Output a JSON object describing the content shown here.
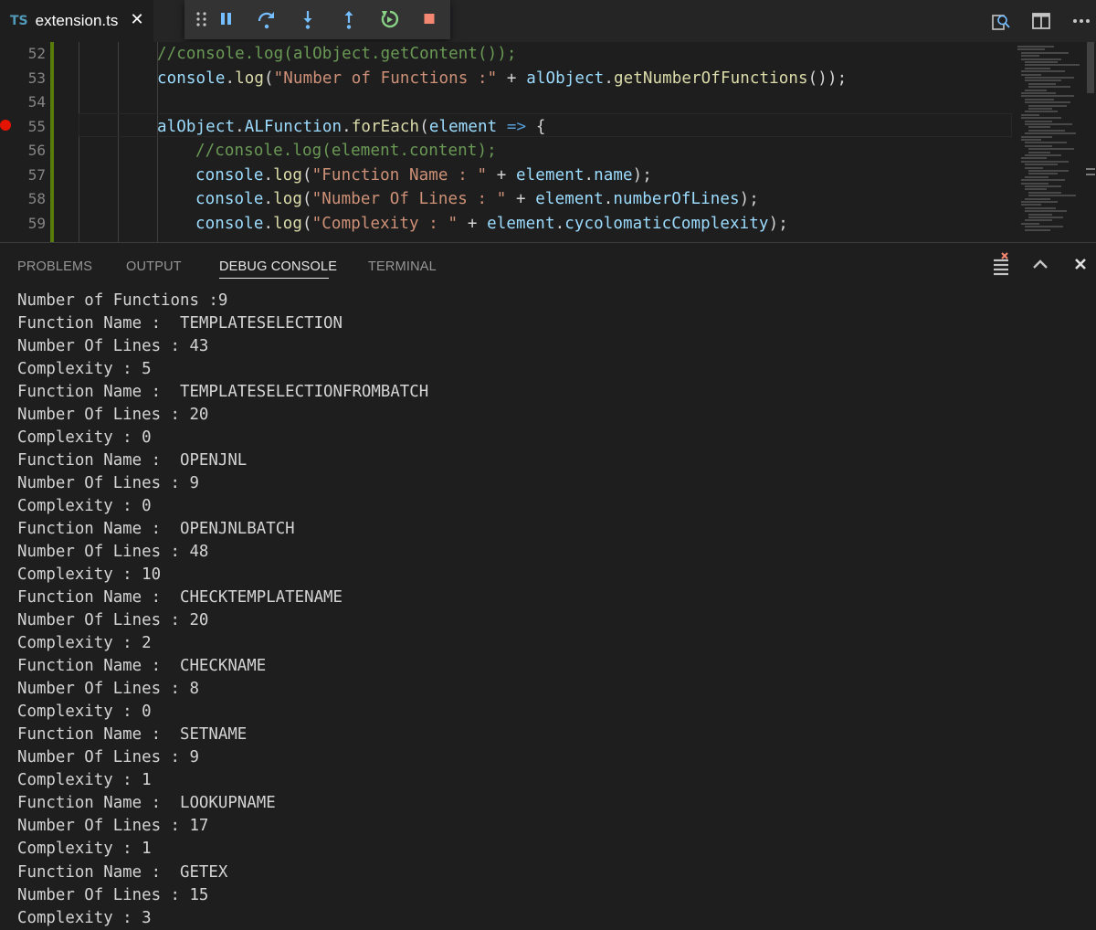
{
  "tab": {
    "badge": "TS",
    "filename": "extension.ts",
    "close_glyph": "✕"
  },
  "debug_toolbar": {
    "icons": [
      "drag-handle-icon",
      "pause-icon",
      "step-over-icon",
      "step-into-icon",
      "step-out-icon",
      "restart-icon",
      "stop-icon"
    ],
    "colors": {
      "blue": "#75beff",
      "green": "#89d185",
      "red": "#f48771"
    }
  },
  "editor_actions": [
    "open-changes-icon",
    "split-editor-icon",
    "more-actions-icon"
  ],
  "editor": {
    "lines": [
      {
        "num": "52",
        "segments": [
          {
            "t": "//console.log(alObject.getContent());",
            "c": "c-comment"
          }
        ],
        "indent": 172
      },
      {
        "num": "53",
        "segments": [
          {
            "t": "console",
            "c": "c-var"
          },
          {
            "t": ".",
            "c": "c-op"
          },
          {
            "t": "log",
            "c": "c-fn"
          },
          {
            "t": "(",
            "c": "c-op"
          },
          {
            "t": "\"Number of Functions :\"",
            "c": "c-str"
          },
          {
            "t": " + ",
            "c": "c-op"
          },
          {
            "t": "alObject",
            "c": "c-var"
          },
          {
            "t": ".",
            "c": "c-op"
          },
          {
            "t": "getNumberOfFunctions",
            "c": "c-fn"
          },
          {
            "t": "());",
            "c": "c-op"
          }
        ],
        "indent": 172
      },
      {
        "num": "54",
        "segments": [],
        "indent": 172
      },
      {
        "num": "55",
        "segments": [
          {
            "t": "alObject",
            "c": "c-var"
          },
          {
            "t": ".",
            "c": "c-op"
          },
          {
            "t": "ALFunction",
            "c": "c-var"
          },
          {
            "t": ".",
            "c": "c-op"
          },
          {
            "t": "forEach",
            "c": "c-fn"
          },
          {
            "t": "(",
            "c": "c-op"
          },
          {
            "t": "element",
            "c": "c-var"
          },
          {
            "t": " => ",
            "c": "c-kw"
          },
          {
            "t": "{",
            "c": "c-op"
          }
        ],
        "indent": 172
      },
      {
        "num": "56",
        "segments": [
          {
            "t": "//console.log(element.content);",
            "c": "c-comment"
          }
        ],
        "indent": 214
      },
      {
        "num": "57",
        "segments": [
          {
            "t": "console",
            "c": "c-var"
          },
          {
            "t": ".",
            "c": "c-op"
          },
          {
            "t": "log",
            "c": "c-fn"
          },
          {
            "t": "(",
            "c": "c-op"
          },
          {
            "t": "\"Function Name : \"",
            "c": "c-str"
          },
          {
            "t": " + ",
            "c": "c-op"
          },
          {
            "t": "element",
            "c": "c-var"
          },
          {
            "t": ".",
            "c": "c-op"
          },
          {
            "t": "name",
            "c": "c-var"
          },
          {
            "t": ");",
            "c": "c-op"
          }
        ],
        "indent": 214
      },
      {
        "num": "58",
        "segments": [
          {
            "t": "console",
            "c": "c-var"
          },
          {
            "t": ".",
            "c": "c-op"
          },
          {
            "t": "log",
            "c": "c-fn"
          },
          {
            "t": "(",
            "c": "c-op"
          },
          {
            "t": "\"Number Of Lines : \"",
            "c": "c-str"
          },
          {
            "t": " + ",
            "c": "c-op"
          },
          {
            "t": "element",
            "c": "c-var"
          },
          {
            "t": ".",
            "c": "c-op"
          },
          {
            "t": "numberOfLines",
            "c": "c-var"
          },
          {
            "t": ");",
            "c": "c-op"
          }
        ],
        "indent": 214
      },
      {
        "num": "59",
        "segments": [
          {
            "t": "console",
            "c": "c-var"
          },
          {
            "t": ".",
            "c": "c-op"
          },
          {
            "t": "log",
            "c": "c-fn"
          },
          {
            "t": "(",
            "c": "c-op"
          },
          {
            "t": "\"Complexity : \"",
            "c": "c-str"
          },
          {
            "t": " + ",
            "c": "c-op"
          },
          {
            "t": "element",
            "c": "c-var"
          },
          {
            "t": ".",
            "c": "c-op"
          },
          {
            "t": "cycolomaticComplexity",
            "c": "c-var"
          },
          {
            "t": ");",
            "c": "c-op"
          }
        ],
        "indent": 214
      }
    ],
    "breakpoint_line": "55",
    "colors": {
      "breakpoint": "#e51400",
      "modified_gutter": "#587c0c"
    }
  },
  "panel": {
    "tabs": [
      {
        "label": "PROBLEMS",
        "active": false
      },
      {
        "label": "OUTPUT",
        "active": false
      },
      {
        "label": "DEBUG CONSOLE",
        "active": true
      },
      {
        "label": "TERMINAL",
        "active": false
      }
    ],
    "actions": [
      "clear-console-icon",
      "maximize-panel-icon",
      "close-panel-icon"
    ]
  },
  "console": {
    "lines": [
      "Number of Functions :9",
      "Function Name :  TEMPLATESELECTION",
      "Number Of Lines : 43",
      "Complexity : 5",
      "Function Name :  TEMPLATESELECTIONFROMBATCH",
      "Number Of Lines : 20",
      "Complexity : 0",
      "Function Name :  OPENJNL",
      "Number Of Lines : 9",
      "Complexity : 0",
      "Function Name :  OPENJNLBATCH",
      "Number Of Lines : 48",
      "Complexity : 10",
      "Function Name :  CHECKTEMPLATENAME",
      "Number Of Lines : 20",
      "Complexity : 2",
      "Function Name :  CHECKNAME",
      "Number Of Lines : 8",
      "Complexity : 0",
      "Function Name :  SETNAME",
      "Number Of Lines : 9",
      "Complexity : 1",
      "Function Name :  LOOKUPNAME",
      "Number Of Lines : 17",
      "Complexity : 1",
      "Function Name :  GETEX",
      "Number Of Lines : 15",
      "Complexity : 3"
    ]
  }
}
